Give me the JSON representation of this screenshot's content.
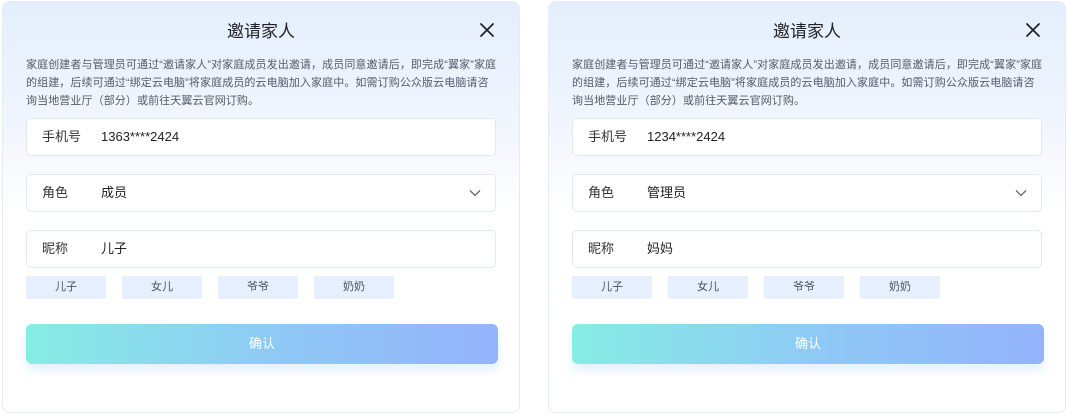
{
  "dialogs": [
    {
      "title": "邀请家人",
      "close_icon": "close-icon",
      "description": "家庭创建者与管理员可通过“邀请家人”对家庭成员发出邀请，成员同意邀请后，即完成“翼家”家庭的组建，后续可通过“绑定云电脑”将家庭成员的云电脑加入家庭中。如需订购公众版云电脑请咨询当地营业厅（部分）或前往天翼云官网订购。",
      "phone": {
        "label": "手机号",
        "value": "1363****2424"
      },
      "role": {
        "label": "角色",
        "value": "成员",
        "icon": "chevron-down-icon"
      },
      "nickname": {
        "label": "昵称",
        "value": "儿子"
      },
      "chips": [
        "儿子",
        "女儿",
        "爷爷",
        "奶奶"
      ],
      "confirm_label": "确认"
    },
    {
      "title": "邀请家人",
      "close_icon": "close-icon",
      "description": "家庭创建者与管理员可通过“邀请家人”对家庭成员发出邀请，成员同意邀请后，即完成“翼家”家庭的组建，后续可通过“绑定云电脑”将家庭成员的云电脑加入家庭中。如需订购公众版云电脑请咨询当地营业厅（部分）或前往天翼云官网订购。",
      "phone": {
        "label": "手机号",
        "value": "1234****2424"
      },
      "role": {
        "label": "角色",
        "value": "管理员",
        "icon": "chevron-down-icon"
      },
      "nickname": {
        "label": "昵称",
        "value": "妈妈"
      },
      "chips": [
        "儿子",
        "女儿",
        "爷爷",
        "奶奶"
      ],
      "confirm_label": "确认"
    }
  ],
  "colors": {
    "chip_background": "#e6effd",
    "button_gradient_start": "#86ede4",
    "button_gradient_end": "#94b3fb",
    "header_gradient": "#e4eefd"
  }
}
